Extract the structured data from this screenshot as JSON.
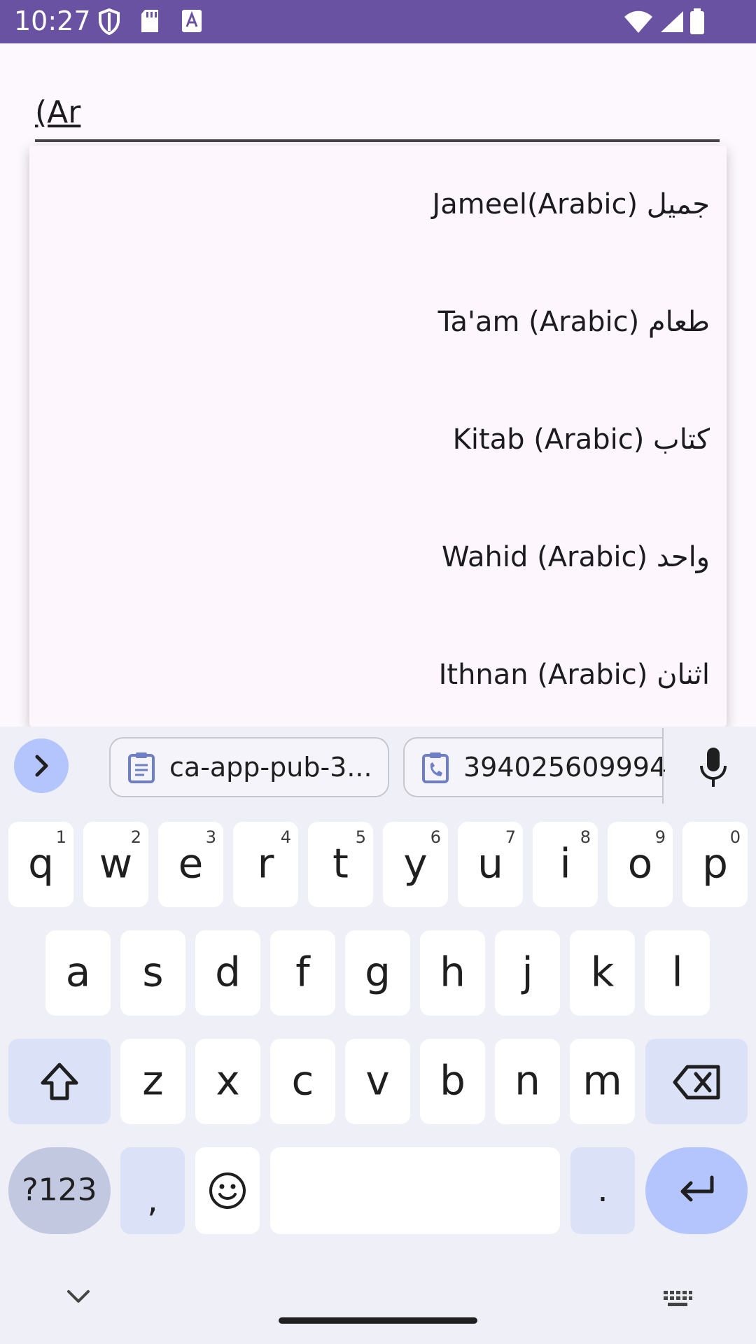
{
  "status_bar": {
    "time": "10:27"
  },
  "search_field": {
    "value": "(Ar"
  },
  "dropdown": {
    "items": [
      "Jameel(Arabic) جميل",
      "Ta'am (Arabic) طعام",
      "Kitab (Arabic) كتاب",
      "Wahid (Arabic) واحد",
      "Ithnan (Arabic) اثنان"
    ]
  },
  "keyboard": {
    "suggestions": [
      "ca-app-pub-3...",
      "394025609994"
    ],
    "row1": [
      {
        "k": "q",
        "h": "1"
      },
      {
        "k": "w",
        "h": "2"
      },
      {
        "k": "e",
        "h": "3"
      },
      {
        "k": "r",
        "h": "4"
      },
      {
        "k": "t",
        "h": "5"
      },
      {
        "k": "y",
        "h": "6"
      },
      {
        "k": "u",
        "h": "7"
      },
      {
        "k": "i",
        "h": "8"
      },
      {
        "k": "o",
        "h": "9"
      },
      {
        "k": "p",
        "h": "0"
      }
    ],
    "row2": [
      "a",
      "s",
      "d",
      "f",
      "g",
      "h",
      "j",
      "k",
      "l"
    ],
    "row3": [
      "z",
      "x",
      "c",
      "v",
      "b",
      "n",
      "m"
    ],
    "symbols_label": "?123",
    "comma_label": ",",
    "period_label": "."
  },
  "colors": {
    "status_bar": "#6a52a2",
    "accent": "#b3c5fc",
    "key_mod": "#dbe1f7"
  }
}
